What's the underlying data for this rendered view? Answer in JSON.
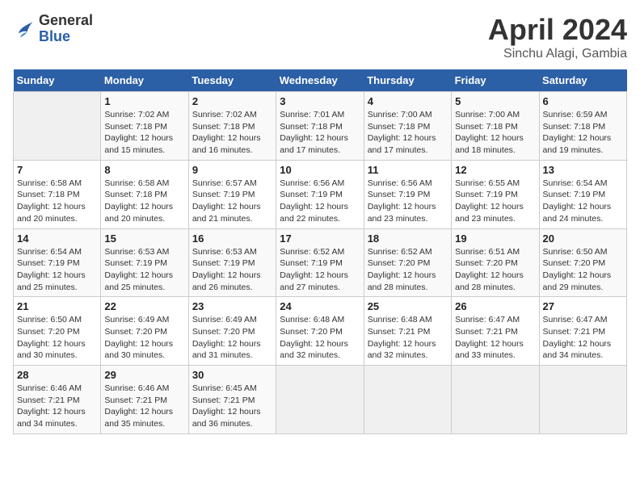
{
  "header": {
    "logo_general": "General",
    "logo_blue": "Blue",
    "title": "April 2024",
    "subtitle": "Sinchu Alagi, Gambia"
  },
  "days_of_week": [
    "Sunday",
    "Monday",
    "Tuesday",
    "Wednesday",
    "Thursday",
    "Friday",
    "Saturday"
  ],
  "weeks": [
    [
      {
        "day": "",
        "sunrise": "",
        "sunset": "",
        "daylight": ""
      },
      {
        "day": "1",
        "sunrise": "Sunrise: 7:02 AM",
        "sunset": "Sunset: 7:18 PM",
        "daylight": "Daylight: 12 hours and 15 minutes."
      },
      {
        "day": "2",
        "sunrise": "Sunrise: 7:02 AM",
        "sunset": "Sunset: 7:18 PM",
        "daylight": "Daylight: 12 hours and 16 minutes."
      },
      {
        "day": "3",
        "sunrise": "Sunrise: 7:01 AM",
        "sunset": "Sunset: 7:18 PM",
        "daylight": "Daylight: 12 hours and 17 minutes."
      },
      {
        "day": "4",
        "sunrise": "Sunrise: 7:00 AM",
        "sunset": "Sunset: 7:18 PM",
        "daylight": "Daylight: 12 hours and 17 minutes."
      },
      {
        "day": "5",
        "sunrise": "Sunrise: 7:00 AM",
        "sunset": "Sunset: 7:18 PM",
        "daylight": "Daylight: 12 hours and 18 minutes."
      },
      {
        "day": "6",
        "sunrise": "Sunrise: 6:59 AM",
        "sunset": "Sunset: 7:18 PM",
        "daylight": "Daylight: 12 hours and 19 minutes."
      }
    ],
    [
      {
        "day": "7",
        "sunrise": "Sunrise: 6:58 AM",
        "sunset": "Sunset: 7:18 PM",
        "daylight": "Daylight: 12 hours and 20 minutes."
      },
      {
        "day": "8",
        "sunrise": "Sunrise: 6:58 AM",
        "sunset": "Sunset: 7:18 PM",
        "daylight": "Daylight: 12 hours and 20 minutes."
      },
      {
        "day": "9",
        "sunrise": "Sunrise: 6:57 AM",
        "sunset": "Sunset: 7:19 PM",
        "daylight": "Daylight: 12 hours and 21 minutes."
      },
      {
        "day": "10",
        "sunrise": "Sunrise: 6:56 AM",
        "sunset": "Sunset: 7:19 PM",
        "daylight": "Daylight: 12 hours and 22 minutes."
      },
      {
        "day": "11",
        "sunrise": "Sunrise: 6:56 AM",
        "sunset": "Sunset: 7:19 PM",
        "daylight": "Daylight: 12 hours and 23 minutes."
      },
      {
        "day": "12",
        "sunrise": "Sunrise: 6:55 AM",
        "sunset": "Sunset: 7:19 PM",
        "daylight": "Daylight: 12 hours and 23 minutes."
      },
      {
        "day": "13",
        "sunrise": "Sunrise: 6:54 AM",
        "sunset": "Sunset: 7:19 PM",
        "daylight": "Daylight: 12 hours and 24 minutes."
      }
    ],
    [
      {
        "day": "14",
        "sunrise": "Sunrise: 6:54 AM",
        "sunset": "Sunset: 7:19 PM",
        "daylight": "Daylight: 12 hours and 25 minutes."
      },
      {
        "day": "15",
        "sunrise": "Sunrise: 6:53 AM",
        "sunset": "Sunset: 7:19 PM",
        "daylight": "Daylight: 12 hours and 25 minutes."
      },
      {
        "day": "16",
        "sunrise": "Sunrise: 6:53 AM",
        "sunset": "Sunset: 7:19 PM",
        "daylight": "Daylight: 12 hours and 26 minutes."
      },
      {
        "day": "17",
        "sunrise": "Sunrise: 6:52 AM",
        "sunset": "Sunset: 7:19 PM",
        "daylight": "Daylight: 12 hours and 27 minutes."
      },
      {
        "day": "18",
        "sunrise": "Sunrise: 6:52 AM",
        "sunset": "Sunset: 7:20 PM",
        "daylight": "Daylight: 12 hours and 28 minutes."
      },
      {
        "day": "19",
        "sunrise": "Sunrise: 6:51 AM",
        "sunset": "Sunset: 7:20 PM",
        "daylight": "Daylight: 12 hours and 28 minutes."
      },
      {
        "day": "20",
        "sunrise": "Sunrise: 6:50 AM",
        "sunset": "Sunset: 7:20 PM",
        "daylight": "Daylight: 12 hours and 29 minutes."
      }
    ],
    [
      {
        "day": "21",
        "sunrise": "Sunrise: 6:50 AM",
        "sunset": "Sunset: 7:20 PM",
        "daylight": "Daylight: 12 hours and 30 minutes."
      },
      {
        "day": "22",
        "sunrise": "Sunrise: 6:49 AM",
        "sunset": "Sunset: 7:20 PM",
        "daylight": "Daylight: 12 hours and 30 minutes."
      },
      {
        "day": "23",
        "sunrise": "Sunrise: 6:49 AM",
        "sunset": "Sunset: 7:20 PM",
        "daylight": "Daylight: 12 hours and 31 minutes."
      },
      {
        "day": "24",
        "sunrise": "Sunrise: 6:48 AM",
        "sunset": "Sunset: 7:20 PM",
        "daylight": "Daylight: 12 hours and 32 minutes."
      },
      {
        "day": "25",
        "sunrise": "Sunrise: 6:48 AM",
        "sunset": "Sunset: 7:21 PM",
        "daylight": "Daylight: 12 hours and 32 minutes."
      },
      {
        "day": "26",
        "sunrise": "Sunrise: 6:47 AM",
        "sunset": "Sunset: 7:21 PM",
        "daylight": "Daylight: 12 hours and 33 minutes."
      },
      {
        "day": "27",
        "sunrise": "Sunrise: 6:47 AM",
        "sunset": "Sunset: 7:21 PM",
        "daylight": "Daylight: 12 hours and 34 minutes."
      }
    ],
    [
      {
        "day": "28",
        "sunrise": "Sunrise: 6:46 AM",
        "sunset": "Sunset: 7:21 PM",
        "daylight": "Daylight: 12 hours and 34 minutes."
      },
      {
        "day": "29",
        "sunrise": "Sunrise: 6:46 AM",
        "sunset": "Sunset: 7:21 PM",
        "daylight": "Daylight: 12 hours and 35 minutes."
      },
      {
        "day": "30",
        "sunrise": "Sunrise: 6:45 AM",
        "sunset": "Sunset: 7:21 PM",
        "daylight": "Daylight: 12 hours and 36 minutes."
      },
      {
        "day": "",
        "sunrise": "",
        "sunset": "",
        "daylight": ""
      },
      {
        "day": "",
        "sunrise": "",
        "sunset": "",
        "daylight": ""
      },
      {
        "day": "",
        "sunrise": "",
        "sunset": "",
        "daylight": ""
      },
      {
        "day": "",
        "sunrise": "",
        "sunset": "",
        "daylight": ""
      }
    ]
  ]
}
